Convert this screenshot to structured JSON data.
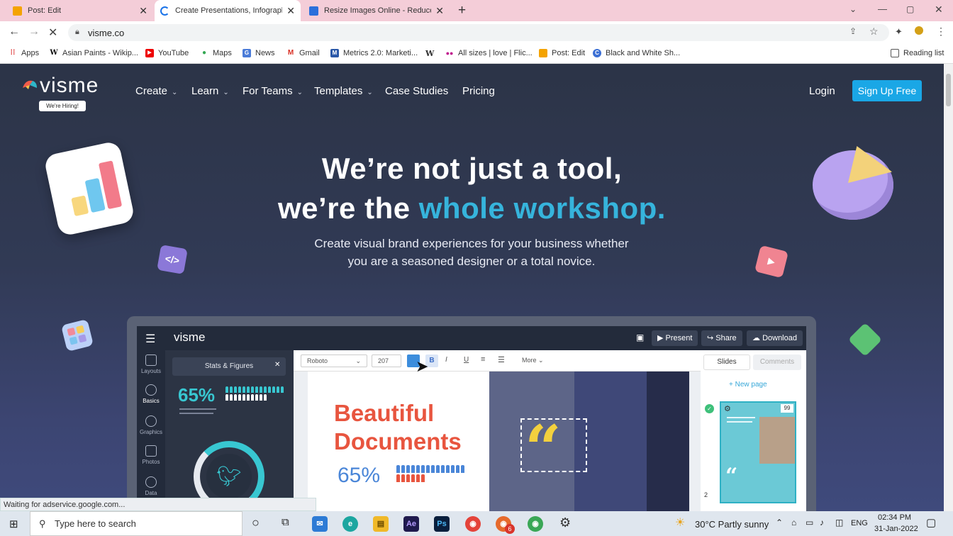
{
  "browser": {
    "tabs": [
      {
        "label": "Post: Edit",
        "active": false
      },
      {
        "label": "Create Presentations, Infographic",
        "active": true
      },
      {
        "label": "Resize Images Online - Reduce J",
        "active": false
      }
    ],
    "new_tab": "+",
    "url": "visme.co",
    "bookmarks": [
      "Apps",
      "Asian Paints - Wikip...",
      "YouTube",
      "Maps",
      "News",
      "Gmail",
      "Metrics 2.0: Marketi...",
      "W",
      "All sizes | love | Flic...",
      "Post: Edit",
      "Black and White Sh..."
    ],
    "reading_list": "Reading list",
    "status": "Waiting for adservice.google.com..."
  },
  "site": {
    "logo": "visme",
    "hiring_badge": "We're Hiring!",
    "nav": [
      "Create",
      "Learn",
      "For Teams",
      "Templates",
      "Case Studies",
      "Pricing"
    ],
    "login": "Login",
    "signup": "Sign Up Free",
    "headline_1": "We’re not just a tool,",
    "headline_2_prefix": "we’re the ",
    "headline_2_highlight": "whole workshop.",
    "subheadline_1": "Create visual brand experiences for your business whether",
    "subheadline_2": "you are a seasoned designer or a total novice."
  },
  "app_mock": {
    "logo": "visme",
    "present": "Present",
    "share": "Share",
    "download": "Download",
    "rail": [
      "Layouts",
      "Basics",
      "Graphics",
      "Photos",
      "Data"
    ],
    "panel_title": "Stats & Figures",
    "stat_value": "65%",
    "font": "Roboto",
    "font_size": "207",
    "more": "More",
    "canvas_title_1": "Beautiful",
    "canvas_title_2": "Documents",
    "canvas_stat": "65%",
    "slides_tab": "Slides",
    "comments_tab": "Comments",
    "new_page": "+ New page",
    "page_count": "99",
    "page_number": "2"
  },
  "taskbar": {
    "search_placeholder": "Type here to search",
    "weather": "30°C  Partly sunny",
    "lang": "ENG",
    "time": "02:34 PM",
    "date": "31-Jan-2022",
    "badge": "6"
  },
  "colors": {
    "accent": "#1aa7e6",
    "highlight": "#36b4dc",
    "tab_strip": "#f4cdd8",
    "canvas_red": "#e8553f"
  }
}
